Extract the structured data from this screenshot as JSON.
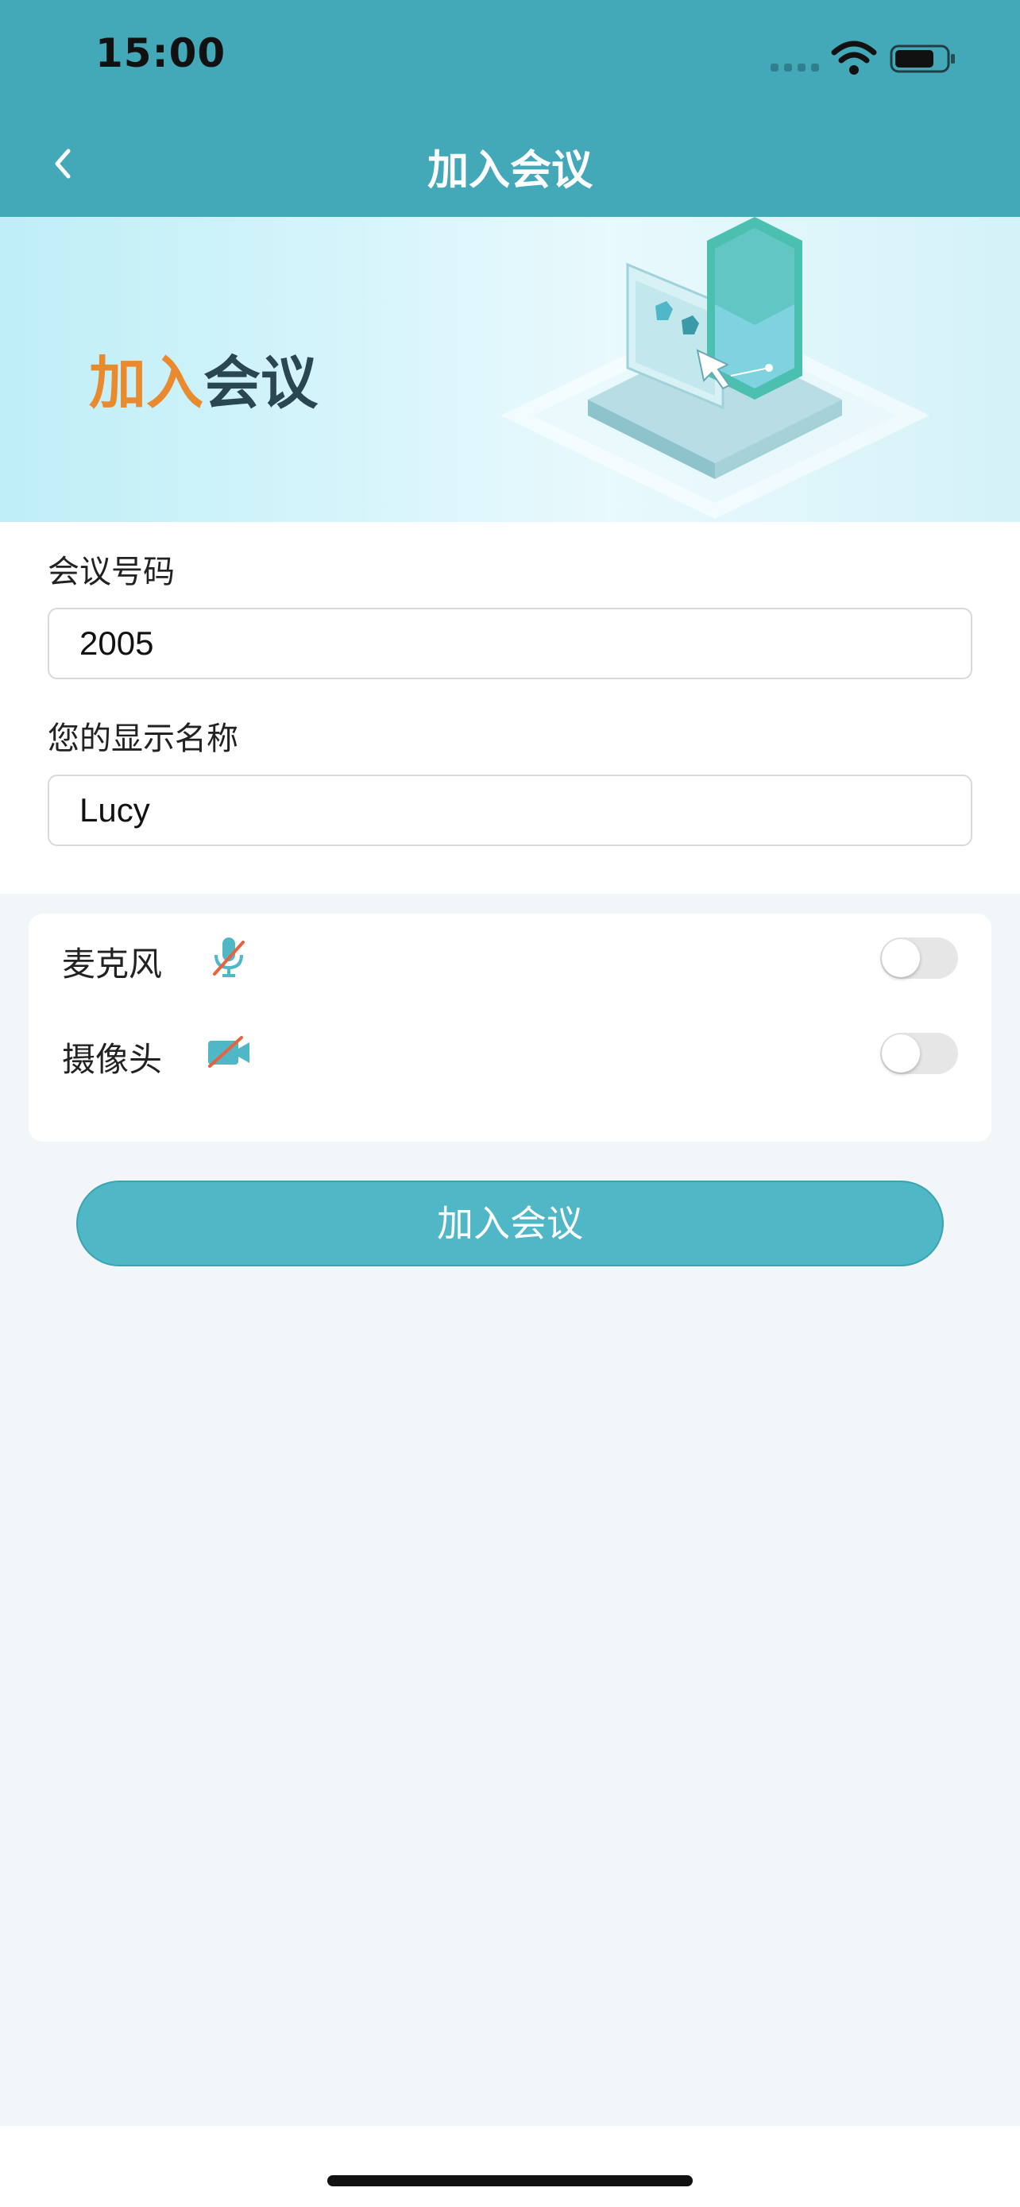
{
  "status_bar": {
    "time": "15:00"
  },
  "nav": {
    "title": "加入会议"
  },
  "banner": {
    "title_part1": "加入",
    "title_part2": "会议"
  },
  "form": {
    "meeting_number_label": "会议号码",
    "meeting_number_value": "2005",
    "display_name_label": "您的显示名称",
    "display_name_value": "Lucy"
  },
  "options": {
    "microphone": {
      "label": "麦克风",
      "icon": "microphone-muted-icon",
      "enabled": false
    },
    "camera": {
      "label": "摄像头",
      "icon": "camera-off-icon",
      "enabled": false
    }
  },
  "actions": {
    "join_label": "加入会议"
  },
  "colors": {
    "header": "#43a9b9",
    "accent_orange": "#e98a2e",
    "button": "#4fb7c5",
    "mute_slash": "#e5633f"
  }
}
